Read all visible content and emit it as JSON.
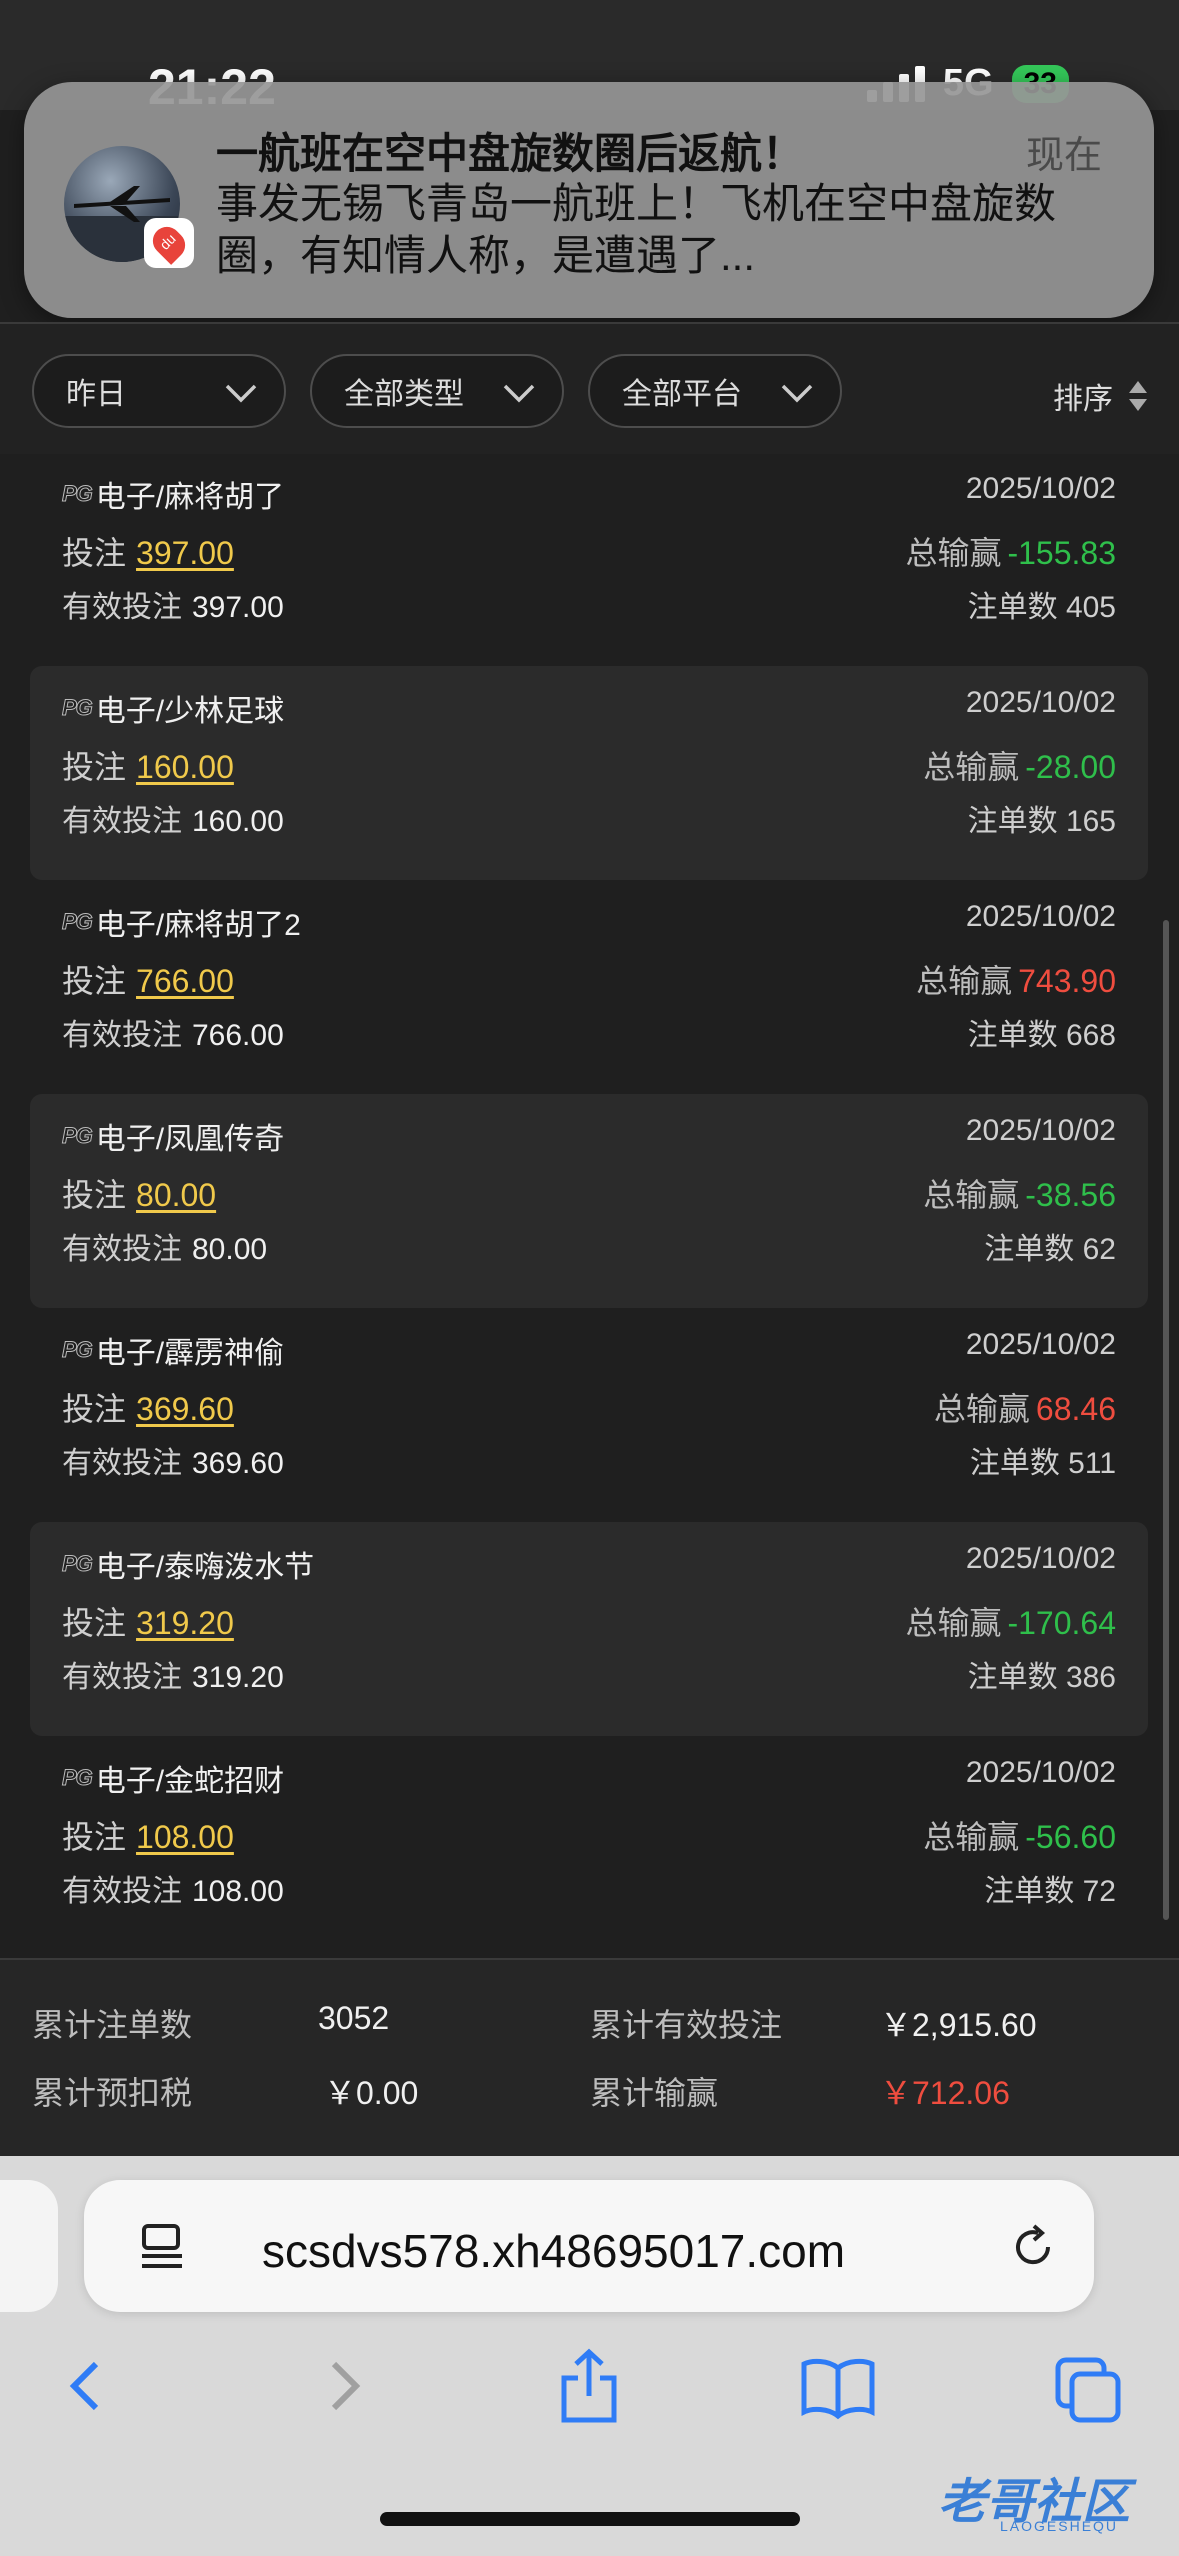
{
  "status": {
    "time": "21:22",
    "network": "5G",
    "battery": "33"
  },
  "notification": {
    "title": "一航班在空中盘旋数圈后返航！",
    "time": "现在",
    "body": "事发无锡飞青岛一航班上！飞机在空中盘旋数圈，有知情人称，是遭遇了...",
    "app_badge": "du"
  },
  "filters": {
    "date": "昨日",
    "type": "全部类型",
    "platform": "全部平台",
    "sort": "排序"
  },
  "labels": {
    "bet": "投注",
    "total_win": "总输赢",
    "valid_bet": "有效投注",
    "orders": "注单数"
  },
  "records": [
    {
      "provider": "PG",
      "game": "电子/麻将胡了",
      "date": "2025/10/02",
      "bet": "397.00",
      "win": "-155.83",
      "valid": "397.00",
      "count": "405"
    },
    {
      "provider": "PG",
      "game": "电子/少林足球",
      "date": "2025/10/02",
      "bet": "160.00",
      "win": "-28.00",
      "valid": "160.00",
      "count": "165"
    },
    {
      "provider": "PG",
      "game": "电子/麻将胡了2",
      "date": "2025/10/02",
      "bet": "766.00",
      "win": "743.90",
      "valid": "766.00",
      "count": "668"
    },
    {
      "provider": "PG",
      "game": "电子/凤凰传奇",
      "date": "2025/10/02",
      "bet": "80.00",
      "win": "-38.56",
      "valid": "80.00",
      "count": "62"
    },
    {
      "provider": "PG",
      "game": "电子/霹雳神偷",
      "date": "2025/10/02",
      "bet": "369.60",
      "win": "68.46",
      "valid": "369.60",
      "count": "511"
    },
    {
      "provider": "PG",
      "game": "电子/泰嗨泼水节",
      "date": "2025/10/02",
      "bet": "319.20",
      "win": "-170.64",
      "valid": "319.20",
      "count": "386"
    },
    {
      "provider": "PG",
      "game": "电子/金蛇招财",
      "date": "2025/10/02",
      "bet": "108.00",
      "win": "-56.60",
      "valid": "108.00",
      "count": "72"
    }
  ],
  "summary": {
    "total_orders_label": "累计注单数",
    "total_orders": "3052",
    "total_valid_label": "累计有效投注",
    "total_valid": "￥2,915.60",
    "tax_label": "累计预扣税",
    "tax": "￥0.00",
    "total_win_label": "累计输赢",
    "total_win": "￥712.06"
  },
  "browser": {
    "url": "scsdvs578.xh48695017.com"
  },
  "watermark": {
    "text": "老哥社区",
    "sub": "LAOGESHEQU"
  },
  "colors": {
    "positive": "#ef4d3f",
    "negative": "#2fbf4b",
    "bet": "#f0c94b"
  }
}
